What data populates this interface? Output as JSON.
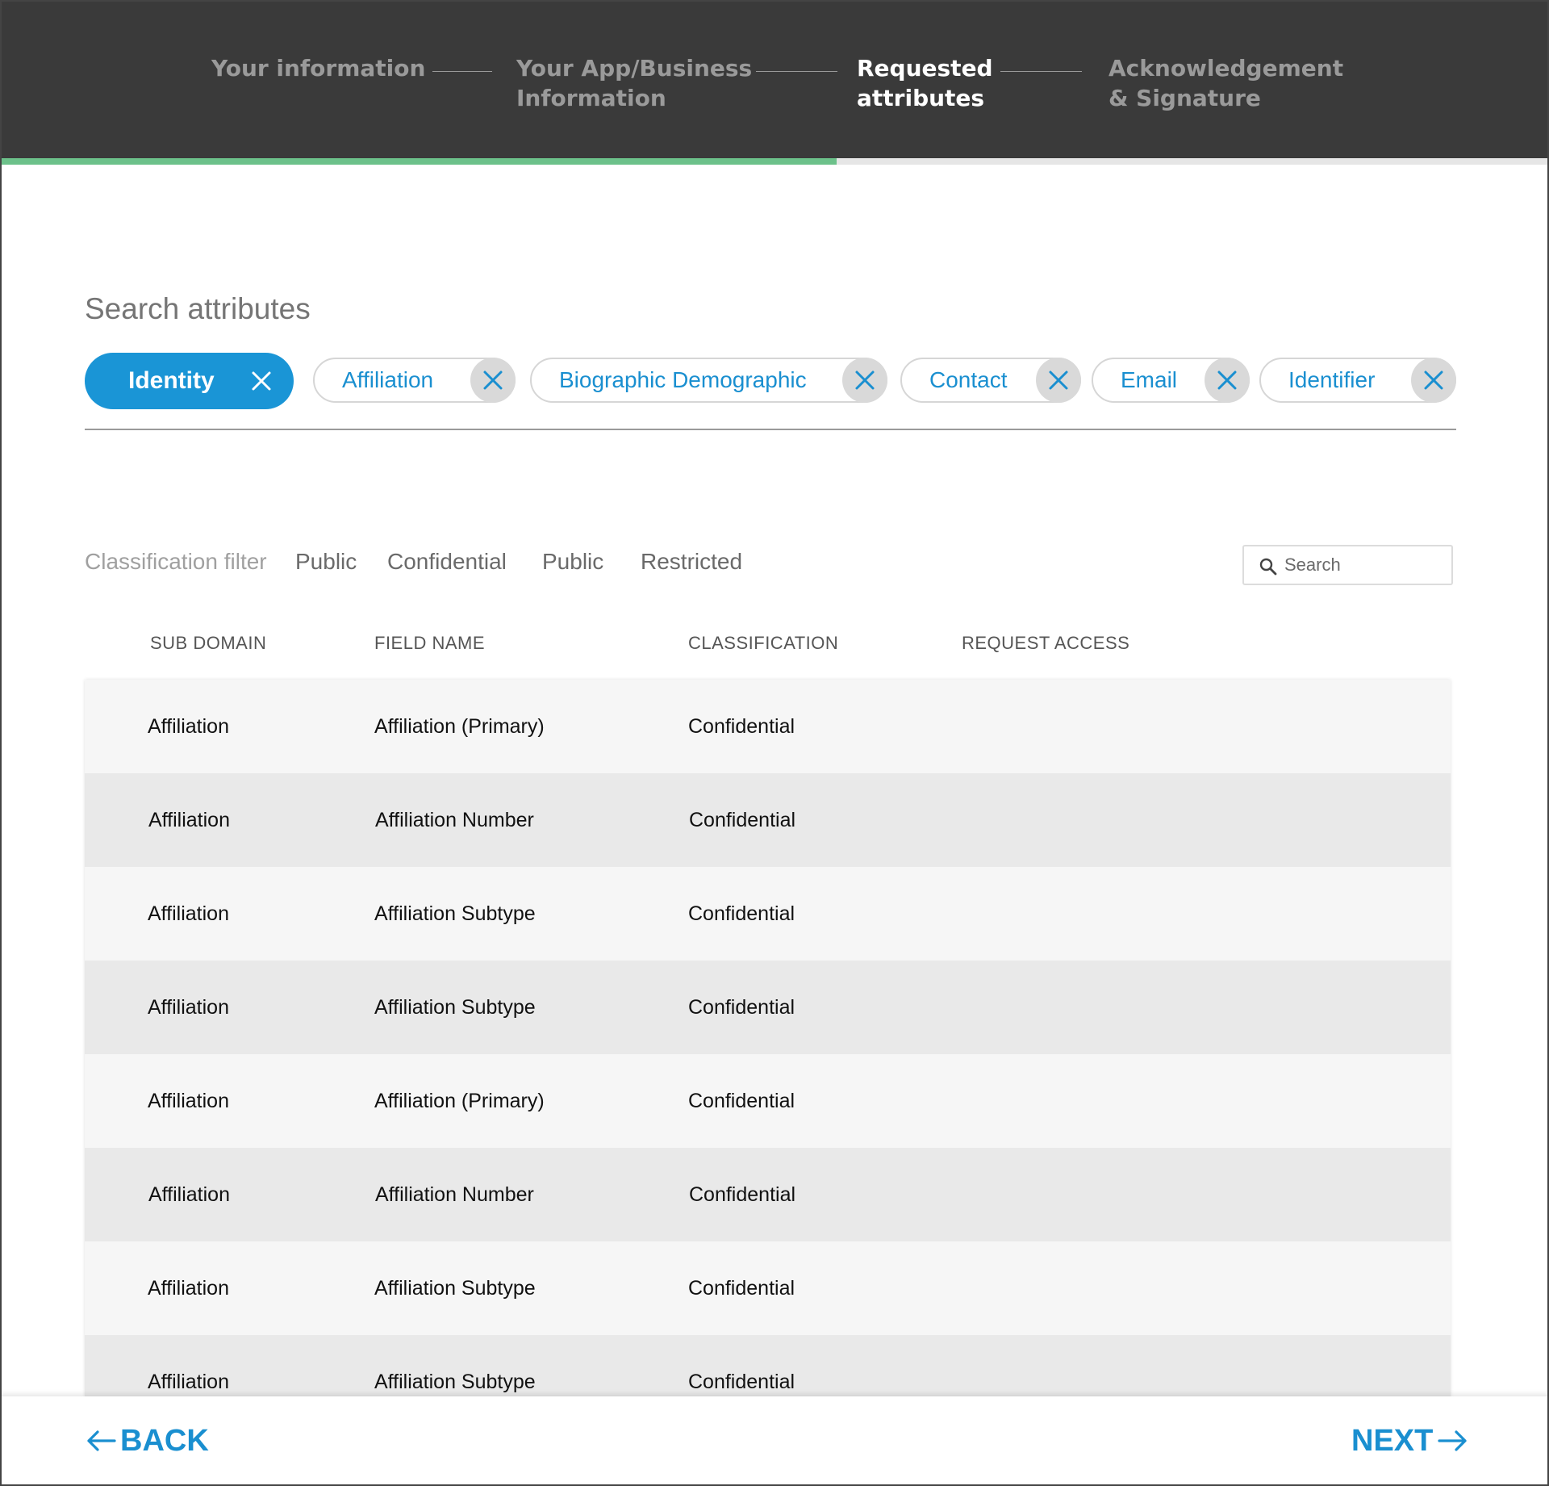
{
  "stepper": {
    "steps": [
      {
        "line1": "Your information",
        "line2": ""
      },
      {
        "line1": "Your App/Business",
        "line2": "Information"
      },
      {
        "line1": "Requested",
        "line2": "attributes"
      },
      {
        "line1": "Acknowledgement",
        "line2": "& Signature"
      }
    ],
    "active_step": 3,
    "progress_percent": 54
  },
  "attributes": {
    "title": "Search attributes",
    "chips": [
      {
        "label": "Identity",
        "selected": true,
        "icon": "close-icon"
      },
      {
        "label": "Affiliation",
        "selected": false,
        "icon": "close-icon"
      },
      {
        "label": "Biographic Demographic",
        "selected": false,
        "icon": "close-icon"
      },
      {
        "label": "Contact",
        "selected": false,
        "icon": "close-icon"
      },
      {
        "label": "Email",
        "selected": false,
        "icon": "close-icon"
      },
      {
        "label": "Identifier",
        "selected": false,
        "icon": "close-icon"
      }
    ]
  },
  "filter": {
    "label": "Classification filter",
    "options": [
      "Public",
      "Confidential",
      "Public",
      "Restricted"
    ],
    "search_placeholder": "Search",
    "search_icon": "search-icon"
  },
  "table": {
    "columns": [
      "SUB DOMAIN",
      "FIELD NAME",
      "CLASSIFICATION",
      "REQUEST ACCESS"
    ],
    "rows": [
      {
        "sub_domain": "Affiliation",
        "field_name": "Affiliation (Primary)",
        "classification": "Confidential"
      },
      {
        "sub_domain": "Affiliation",
        "field_name": "Affiliation Number",
        "classification": "Confidential"
      },
      {
        "sub_domain": "Affiliation",
        "field_name": "Affiliation Subtype",
        "classification": "Confidential"
      },
      {
        "sub_domain": "Affiliation",
        "field_name": "Affiliation Subtype",
        "classification": "Confidential"
      },
      {
        "sub_domain": "Affiliation",
        "field_name": "Affiliation (Primary)",
        "classification": "Confidential"
      },
      {
        "sub_domain": "Affiliation",
        "field_name": "Affiliation Number",
        "classification": "Confidential"
      },
      {
        "sub_domain": "Affiliation",
        "field_name": "Affiliation Subtype",
        "classification": "Confidential"
      },
      {
        "sub_domain": "Affiliation",
        "field_name": "Affiliation Subtype",
        "classification": "Confidential"
      }
    ]
  },
  "footer": {
    "back_label": "BACK",
    "next_label": "NEXT",
    "back_icon": "arrow-left-icon",
    "next_icon": "arrow-right-icon"
  },
  "colors": {
    "header_bg": "#3a3a3a",
    "progress": "#6cc18a",
    "accent": "#1a95d6",
    "row_light": "#f6f6f6",
    "row_dark": "#e9e9e9"
  }
}
